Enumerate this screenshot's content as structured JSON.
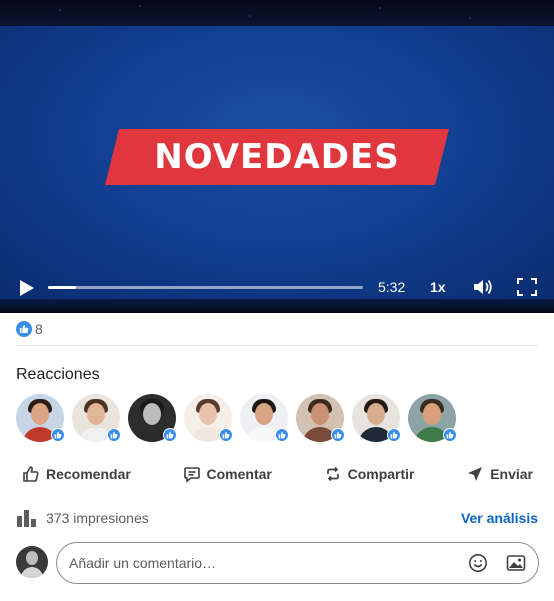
{
  "video": {
    "banner_text": "NOVEDADES",
    "time_remaining": "5:32",
    "playback_speed": "1x",
    "progress": 0.09,
    "icons": [
      "play-icon",
      "volume-icon",
      "fullscreen-icon"
    ]
  },
  "social": {
    "reaction_count": "8"
  },
  "reactions": {
    "title": "Reacciones",
    "avatars": [
      {
        "skin": "#d9a582",
        "hair": "#2a1d16",
        "body": "#c0392b",
        "bg": "#c7d6e6"
      },
      {
        "skin": "#e2b597",
        "hair": "#4a3426",
        "body": "#f0f0f0",
        "bg": "#e9e4dc"
      },
      {
        "skin": "#bcbcbc",
        "hair": "#1b1b1b",
        "body": "#2b2b2b",
        "bg": "#2e2e2e"
      },
      {
        "skin": "#e8c2a8",
        "hair": "#5a3b2b",
        "body": "#efe7df",
        "bg": "#f4efe9"
      },
      {
        "skin": "#d7a585",
        "hair": "#1f1714",
        "body": "#f7f7f7",
        "bg": "#eef0f3"
      },
      {
        "skin": "#c99172",
        "hair": "#3a2a20",
        "body": "#7a4a3a",
        "bg": "#d3c2b3"
      },
      {
        "skin": "#d8ad8e",
        "hair": "#231a15",
        "body": "#1e2a3a",
        "bg": "#e7e4df"
      },
      {
        "skin": "#d9a07d",
        "hair": "#3b2a20",
        "body": "#3f7a4a",
        "bg": "#8da3a8"
      }
    ]
  },
  "actions": {
    "recommend": "Recomendar",
    "comment": "Comentar",
    "share": "Compartir",
    "send": "Enviar"
  },
  "impressions": {
    "text": "373 impresiones",
    "analytics_link": "Ver análisis"
  },
  "comment": {
    "placeholder": "Añadir un comentario…"
  },
  "colors": {
    "accent": "#0a66c2",
    "like": "#378fe9",
    "banner": "#e0373f",
    "video_bg": "#124093"
  }
}
